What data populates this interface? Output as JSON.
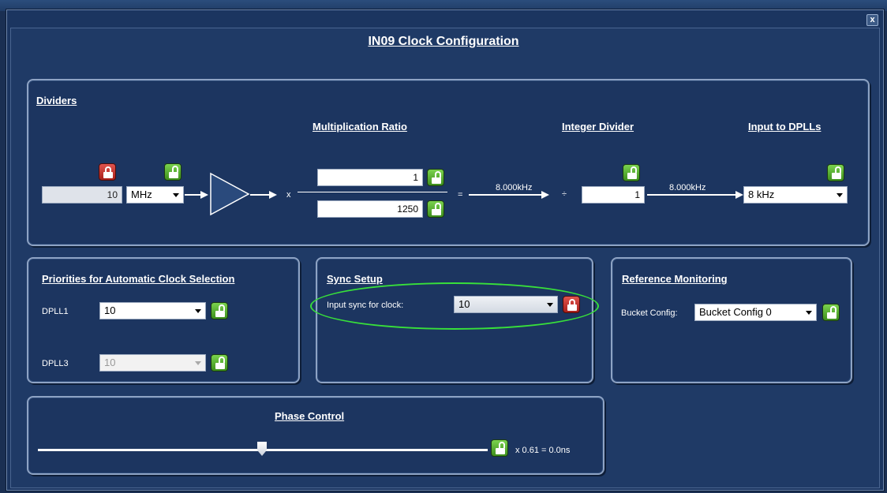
{
  "window": {
    "title": "IN09 Clock Configuration",
    "close_label": "x"
  },
  "dividers": {
    "heading": "Dividers",
    "col_mult": "Multiplication Ratio",
    "col_int": "Integer Divider",
    "col_input": "Input to DPLLs",
    "input_freq": "10",
    "input_unit": "MHz",
    "times": "x",
    "numerator": "1",
    "denominator": "1250",
    "equals": "=",
    "freq1": "8.000kHz",
    "divide": "÷",
    "int_divider": "1",
    "freq2": "8.000kHz",
    "dpll_input": "8 kHz"
  },
  "priorities": {
    "heading": "Priorities for Automatic Clock Selection",
    "dpll1_label": "DPLL1",
    "dpll1_value": "10",
    "dpll3_label": "DPLL3",
    "dpll3_value": "10"
  },
  "sync": {
    "heading": "Sync Setup",
    "label": "Input sync for clock:",
    "value": "10"
  },
  "monitoring": {
    "heading": "Reference Monitoring",
    "label": "Bucket Config:",
    "value": "Bucket Config 0"
  },
  "phase": {
    "heading": "Phase Control",
    "readout": "x 0.61 = 0.0ns",
    "slider_fraction": 0.5
  },
  "colors": {
    "background": "#1f3a66",
    "panel_border": "#8ea3c4",
    "lock_green": "#5cb534",
    "lock_red": "#c93732",
    "highlight": "#38e03a"
  }
}
